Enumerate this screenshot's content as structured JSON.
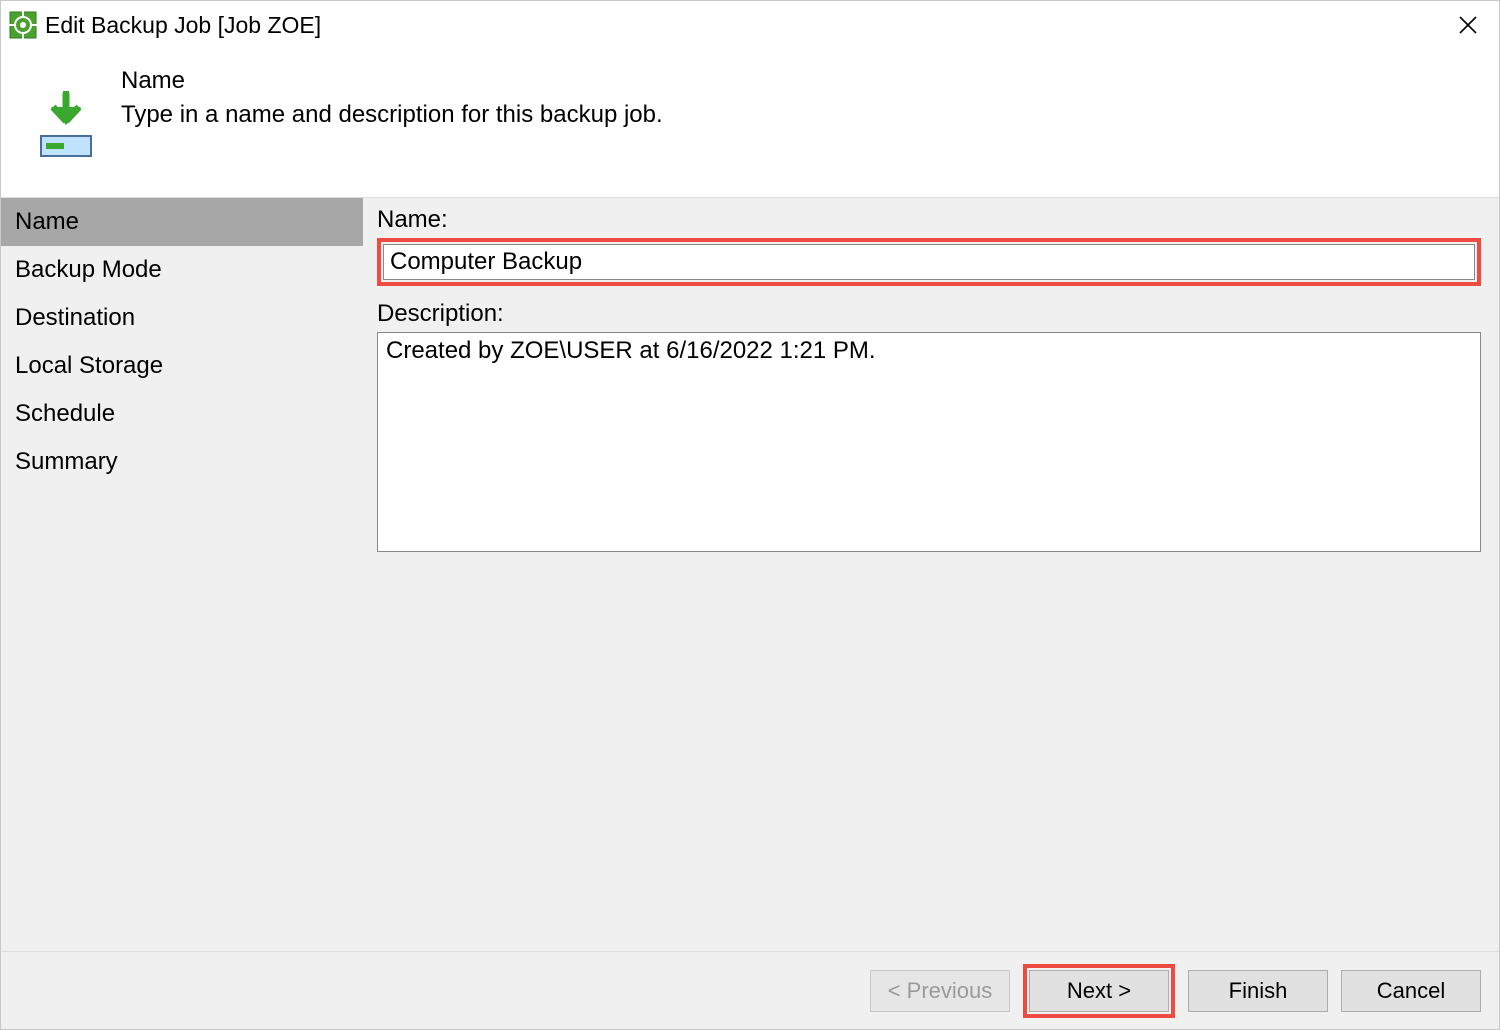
{
  "window": {
    "title": "Edit Backup Job [Job ZOE]"
  },
  "header": {
    "title": "Name",
    "description": "Type in a name and description for this backup job."
  },
  "sidebar": {
    "items": [
      {
        "label": "Name"
      },
      {
        "label": "Backup Mode"
      },
      {
        "label": "Destination"
      },
      {
        "label": "Local Storage"
      },
      {
        "label": "Schedule"
      },
      {
        "label": "Summary"
      }
    ]
  },
  "form": {
    "name_label": "Name:",
    "name_value": "Computer Backup",
    "description_label": "Description:",
    "description_value": "Created by ZOE\\USER at 6/16/2022 1:21 PM."
  },
  "footer": {
    "previous": "< Previous",
    "next": "Next >",
    "finish": "Finish",
    "cancel": "Cancel"
  },
  "colors": {
    "highlight": "#ee4b42",
    "sidebar_active": "#a7a7a7",
    "panel_bg": "#f0f0f0"
  }
}
